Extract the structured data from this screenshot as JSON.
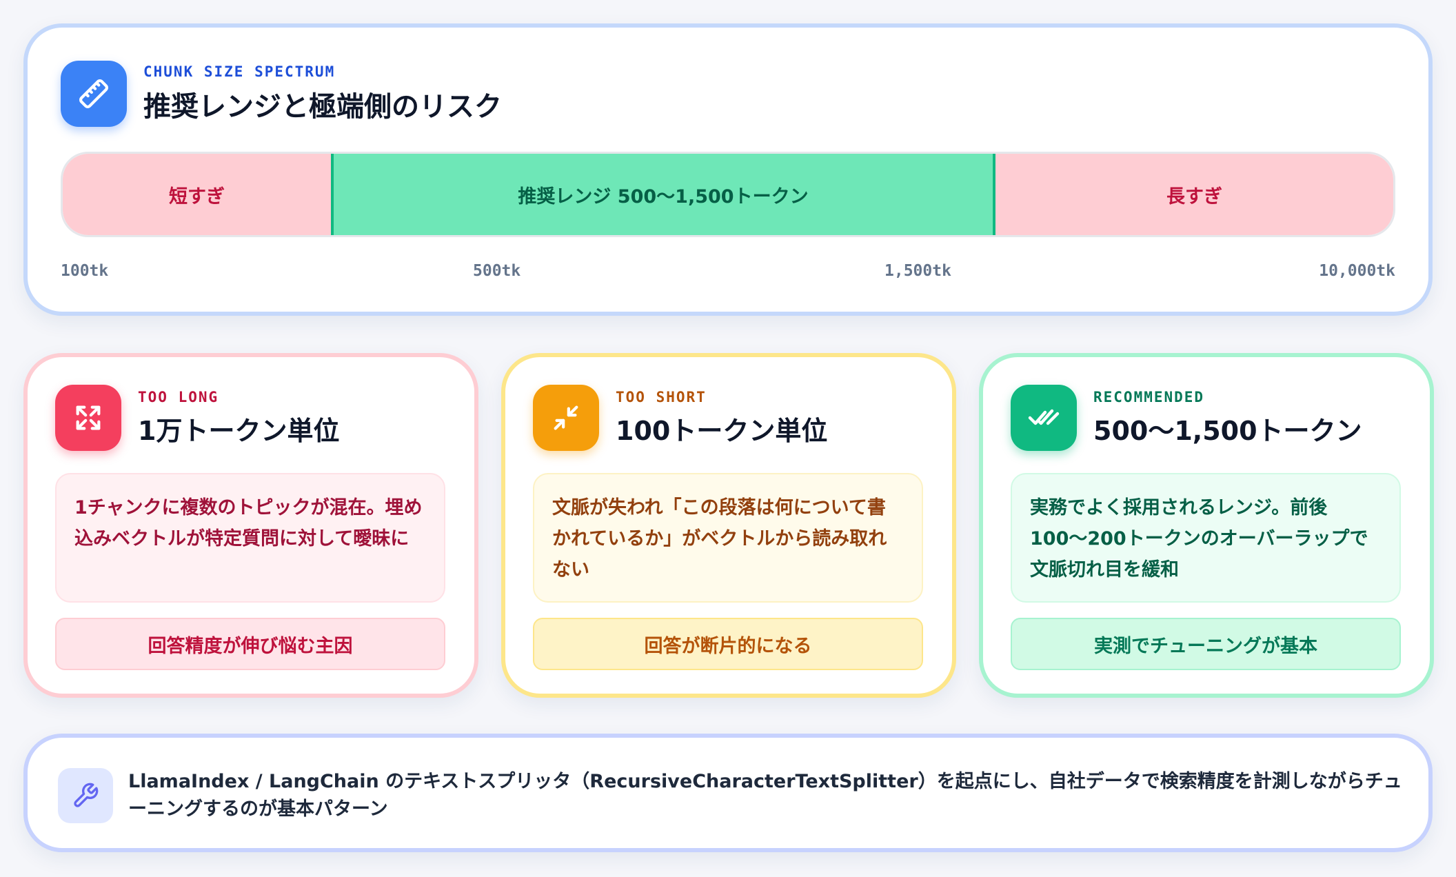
{
  "spectrum": {
    "kicker": "CHUNK SIZE SPECTRUM",
    "title": "推奨レンジと極端側のリスク",
    "icon": "ruler-icon",
    "segments": {
      "short": "短すぎ",
      "recommended": "推奨レンジ 500〜1,500トークン",
      "long": "長すぎ"
    },
    "ticks": [
      "100tk",
      "500tk",
      "1,500tk",
      "10,000tk"
    ]
  },
  "cards": [
    {
      "kicker": "TOO LONG",
      "title": "1万トークン単位",
      "icon": "expand-icon",
      "description": "1チャンクに複数のトピックが混在。埋め込みベクトルが特定質問に対して曖昧に",
      "pill": "回答精度が伸び悩む主因"
    },
    {
      "kicker": "TOO SHORT",
      "title": "100トークン単位",
      "icon": "compress-icon",
      "description": "文脈が失われ「この段落は何について書かれているか」がベクトルから読み取れない",
      "pill": "回答が断片的になる"
    },
    {
      "kicker": "RECOMMENDED",
      "title": "500〜1,500トークン",
      "icon": "double-check-icon",
      "description": "実務でよく採用されるレンジ。前後100〜200トークンのオーバーラップで文脈切れ目を緩和",
      "pill": "実測でチューニングが基本"
    }
  ],
  "note": {
    "icon": "wrench-icon",
    "text": "LlamaIndex / LangChain のテキストスプリッタ（RecursiveCharacterTextSplitter）を起点にし、自社データで検索精度を計測しながらチューニングするのが基本パターン"
  },
  "colors": {
    "blue": "#3b82f6",
    "red": "#f43f5e",
    "amber": "#f59e0b",
    "green": "#10b981"
  }
}
